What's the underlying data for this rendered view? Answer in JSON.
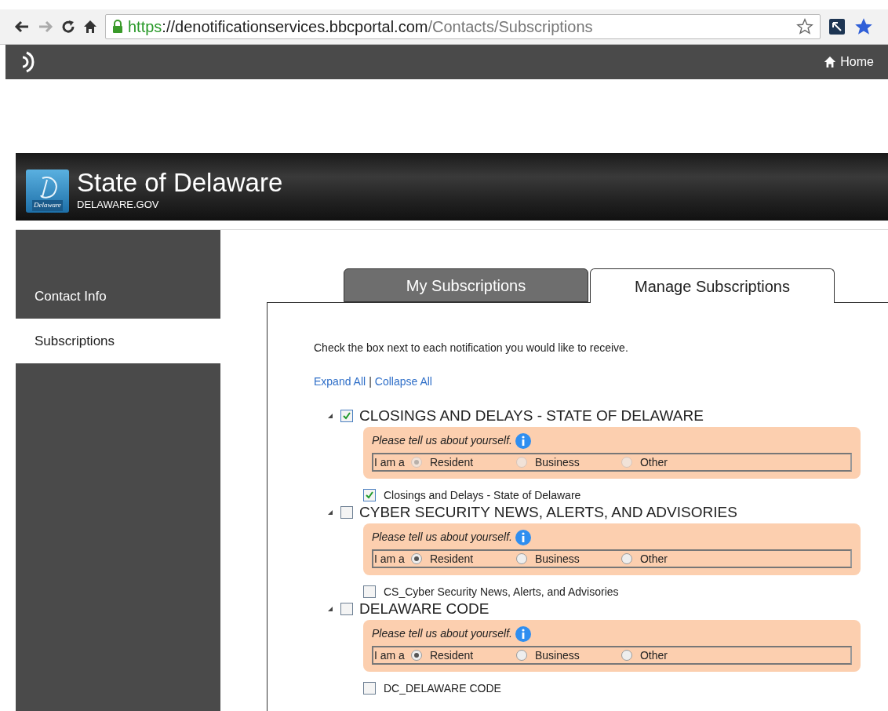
{
  "browser": {
    "url_scheme": "https",
    "url_host": "://denotificationservices.bbcportal.com",
    "url_path": "/Contacts/Subscriptions"
  },
  "site_bar": {
    "home_link": "Home"
  },
  "banner": {
    "title": "State of Delaware",
    "subtitle": "DELAWARE.GOV",
    "logo_text": "Delaware"
  },
  "sidebar": {
    "items": [
      {
        "label": "Contact Info",
        "selected": false
      },
      {
        "label": "Subscriptions",
        "selected": true
      }
    ]
  },
  "tabs": [
    {
      "label": "My Subscriptions",
      "selected": false
    },
    {
      "label": "Manage Subscriptions",
      "selected": true
    }
  ],
  "instructions": "Check the box next to each notification you would like to receive.",
  "links": {
    "expand": "Expand All",
    "separator": "|",
    "collapse": "Collapse All"
  },
  "groups": [
    {
      "title": "CLOSINGS AND DELAYS - STATE OF DELAWARE",
      "checked": true,
      "expanded": true,
      "prompt": "Please tell us about yourself.",
      "radio_label": "I am a",
      "radios_disabled": true,
      "options": [
        {
          "label": "Resident",
          "selected": true
        },
        {
          "label": "Business",
          "selected": false
        },
        {
          "label": "Other",
          "selected": false
        }
      ],
      "item": {
        "label": "Closings and Delays - State of Delaware",
        "checked": true
      }
    },
    {
      "title": "CYBER SECURITY NEWS, ALERTS, AND ADVISORIES",
      "checked": false,
      "expanded": true,
      "prompt": "Please tell us about yourself.",
      "radio_label": "I am a",
      "radios_disabled": false,
      "options": [
        {
          "label": "Resident",
          "selected": true
        },
        {
          "label": "Business",
          "selected": false
        },
        {
          "label": "Other",
          "selected": false
        }
      ],
      "item": {
        "label": "CS_Cyber Security News, Alerts, and Advisories",
        "checked": false
      }
    },
    {
      "title": "DELAWARE CODE",
      "checked": false,
      "expanded": true,
      "prompt": "Please tell us about yourself.",
      "radio_label": "I am a",
      "radios_disabled": false,
      "options": [
        {
          "label": "Resident",
          "selected": true
        },
        {
          "label": "Business",
          "selected": false
        },
        {
          "label": "Other",
          "selected": false
        }
      ],
      "item": {
        "label": "DC_DELAWARE CODE",
        "checked": false
      }
    }
  ]
}
